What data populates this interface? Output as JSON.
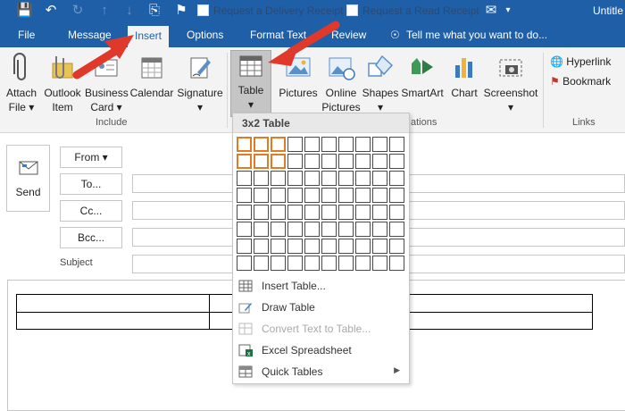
{
  "qat": {
    "request_delivery_receipt": "Request a Delivery Receipt",
    "request_read_receipt": "Request a Read Receipt",
    "window_title": "Untitle"
  },
  "tabs": [
    "File",
    "Message",
    "Insert",
    "Options",
    "Format Text",
    "Review"
  ],
  "tell_me": "Tell me what you want to do...",
  "ribbon": {
    "attach_file": [
      "Attach",
      "File ▾"
    ],
    "outlook_item": [
      "Outlook",
      "Item"
    ],
    "business_card": [
      "Business",
      "Card ▾"
    ],
    "calendar": "Calendar",
    "signature": [
      "Signature",
      "▾"
    ],
    "table": [
      "Table",
      "▾"
    ],
    "pictures": "Pictures",
    "online_pictures": [
      "Online",
      "Pictures"
    ],
    "shapes": [
      "Shapes",
      "▾"
    ],
    "smartart": "SmartArt",
    "chart": "Chart",
    "screenshot": [
      "Screenshot",
      "▾"
    ],
    "hyperlink": "Hyperlink",
    "bookmark": "Bookmark",
    "group_include": "Include",
    "group_illustrations_tail": "ations",
    "group_links": "Links"
  },
  "compose": {
    "send": "Send",
    "from": "From ▾",
    "to": "To...",
    "cc": "Cc...",
    "bcc": "Bcc...",
    "subject": "Subject"
  },
  "table_menu": {
    "title": "3x2 Table",
    "selection": {
      "cols": 3,
      "rows": 2
    },
    "grid": {
      "cols": 10,
      "rows": 8
    },
    "items": [
      {
        "label": "Insert Table...",
        "icon": "insert-table-icon",
        "enabled": true
      },
      {
        "label": "Draw Table",
        "icon": "draw-table-icon",
        "enabled": true
      },
      {
        "label": "Convert Text to Table...",
        "icon": "convert-text-icon",
        "enabled": false
      },
      {
        "label": "Excel Spreadsheet",
        "icon": "excel-icon",
        "enabled": true
      },
      {
        "label": "Quick Tables",
        "icon": "quick-tables-icon",
        "enabled": true,
        "submenu": true
      }
    ]
  },
  "colors": {
    "accent": "#1f5fa7",
    "ribbon": "#f3f3f3",
    "highlight": "#e07b26",
    "arrow": "#e0392b"
  }
}
